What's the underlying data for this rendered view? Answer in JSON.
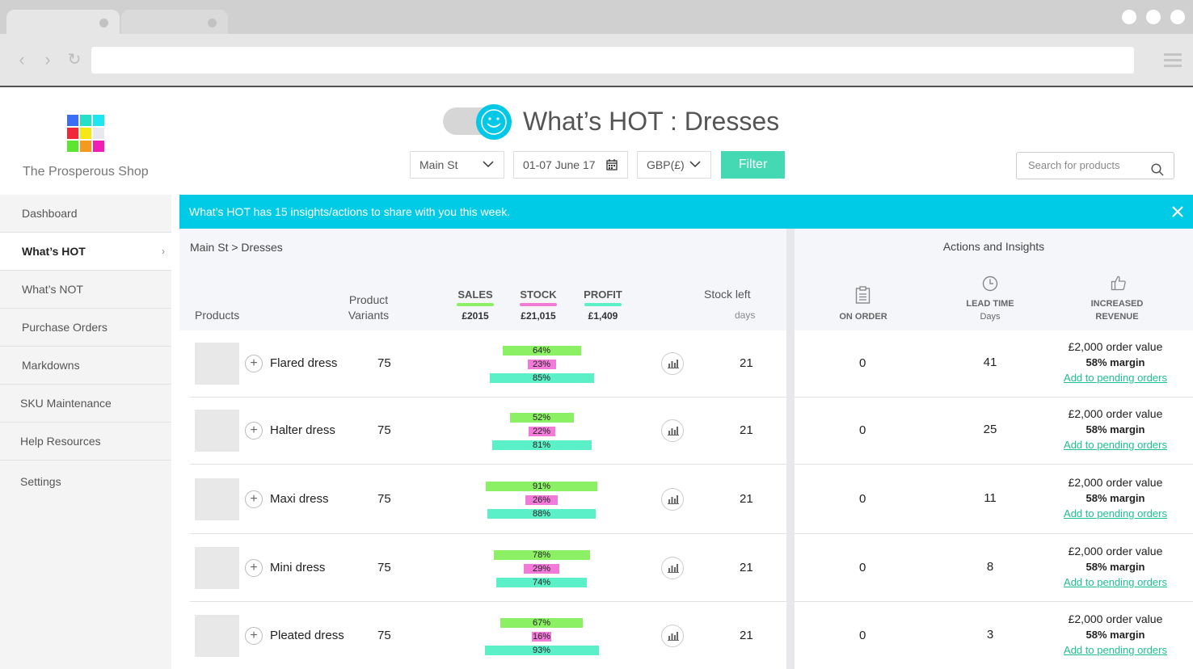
{
  "app": {
    "logo_text": "The Prosperous Shop",
    "page_title": "What’s HOT : Dresses"
  },
  "controls": {
    "store": "Main St",
    "date_range": "01-07 June 17",
    "currency": "GBP(£)",
    "filter_label": "Filter",
    "search_placeholder": "Search for products"
  },
  "sidebar": {
    "items": [
      {
        "label": "Dashboard"
      },
      {
        "label": "What’s HOT",
        "active": true
      },
      {
        "label": "What’s NOT"
      },
      {
        "label": "Purchase Orders"
      },
      {
        "label": "Markdowns"
      },
      {
        "label": "SKU Maintenance"
      },
      {
        "label": "Help Resources"
      },
      {
        "label": "Settings"
      }
    ]
  },
  "banner": {
    "message": "What’s HOT has 15 insights/actions to share with you this week."
  },
  "table": {
    "breadcrumb": "Main St > Dresses",
    "actions_title": "Actions and Insights",
    "headers": {
      "products": "Products",
      "variants_1": "Product",
      "variants_2": "Variants",
      "sales": "SALES",
      "sales_total": "£2015",
      "stock": "STOCK",
      "stock_total": "£21,015",
      "profit": "PROFIT",
      "profit_total": "£1,409",
      "stock_left": "Stock left",
      "stock_left_unit": "days",
      "on_order": "ON ORDER",
      "lead_time": "LEAD TIME",
      "lead_time_unit": "Days",
      "increased_revenue_1": "INCREASED",
      "increased_revenue_2": "REVENUE"
    },
    "colors": {
      "sales": "#8cf064",
      "stock": "#f27ad9",
      "profit": "#5cf0c8",
      "accent": "#00cbe6",
      "filter": "#44d9b3"
    },
    "rows": [
      {
        "name": "Flared dress",
        "variants": "75",
        "sales": "64%",
        "stock": "23%",
        "profit": "85%",
        "stock_left": "21",
        "on_order": "0",
        "lead_time": "41",
        "order_value": "£2,000 order value",
        "margin": "58% margin",
        "action": "Add to pending orders"
      },
      {
        "name": "Halter dress",
        "variants": "75",
        "sales": "52%",
        "stock": "22%",
        "profit": "81%",
        "stock_left": "21",
        "on_order": "0",
        "lead_time": "25",
        "order_value": "£2,000 order value",
        "margin": "58% margin",
        "action": "Add to pending orders"
      },
      {
        "name": "Maxi dress",
        "variants": "75",
        "sales": "91%",
        "stock": "26%",
        "profit": "88%",
        "stock_left": "21",
        "on_order": "0",
        "lead_time": "11",
        "order_value": "£2,000 order value",
        "margin": "58% margin",
        "action": "Add to pending orders"
      },
      {
        "name": "Mini dress",
        "variants": "75",
        "sales": "78%",
        "stock": "29%",
        "profit": "74%",
        "stock_left": "21",
        "on_order": "0",
        "lead_time": "8",
        "order_value": "£2,000 order value",
        "margin": "58% margin",
        "action": "Add to pending orders"
      },
      {
        "name": "Pleated dress",
        "variants": "75",
        "sales": "67%",
        "stock": "16%",
        "profit": "93%",
        "stock_left": "21",
        "on_order": "0",
        "lead_time": "3",
        "order_value": "£2,000 order value",
        "margin": "58% margin",
        "action": "Add to pending orders"
      }
    ]
  }
}
